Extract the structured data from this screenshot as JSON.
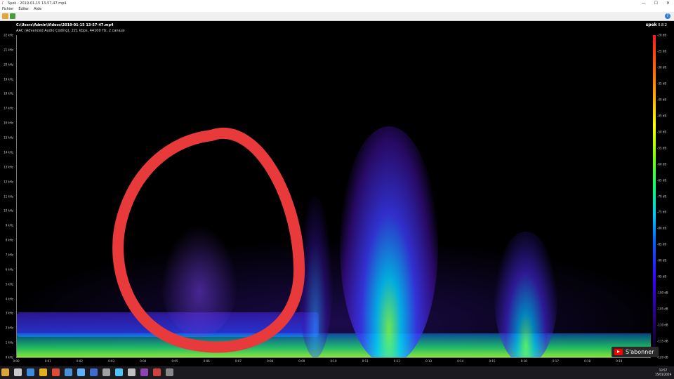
{
  "window": {
    "title": "Spek - 2019-01-15 13-57-47.mp4",
    "minimize": "—",
    "maximize": "☐",
    "close": "✕"
  },
  "menu": [
    "Fichier",
    "Éditer",
    "Aide"
  ],
  "file": {
    "path": "C:\\Users\\Admin\\Videos\\2019-01-15 13-57-47.mp4",
    "meta": "AAC (Advanced Audio Coding), 221 kbps, 44100 Hz, 2 canaux"
  },
  "app": {
    "name": "spek",
    "version": "0.8.2"
  },
  "freq_labels": [
    "22 kHz",
    "21 kHz",
    "20 kHz",
    "19 kHz",
    "18 kHz",
    "17 kHz",
    "16 kHz",
    "15 kHz",
    "14 kHz",
    "13 kHz",
    "12 kHz",
    "11 kHz",
    "10 kHz",
    "9 kHz",
    "8 kHz",
    "7 kHz",
    "6 kHz",
    "5 kHz",
    "4 kHz",
    "3 kHz",
    "2 kHz",
    "1 kHz",
    "0 kHz"
  ],
  "time_labels": [
    "0:00",
    "0:01",
    "0:02",
    "0:03",
    "0:04",
    "0:05",
    "0:06",
    "0:07",
    "0:08",
    "0:09",
    "0:10",
    "0:11",
    "0:12",
    "0:13",
    "0:14",
    "0:15",
    "0:16",
    "0:17",
    "0:18",
    "0:19"
  ],
  "db_labels": [
    "-20 dB",
    "-25 dB",
    "-30 dB",
    "-35 dB",
    "-40 dB",
    "-45 dB",
    "-50 dB",
    "-55 dB",
    "-60 dB",
    "-65 dB",
    "-70 dB",
    "-75 dB",
    "-80 dB",
    "-85 dB",
    "-90 dB",
    "-95 dB",
    "-100 dB",
    "-105 dB",
    "-110 dB",
    "-115 dB",
    "-120 dB"
  ],
  "overlay": {
    "subscribe_label": "S'abonner",
    "circle_color": "#e83a3a"
  },
  "clock": {
    "time": "13:57",
    "date": "15/01/2019"
  },
  "taskbar_icon_colors": [
    "#d9a53b",
    "#c9c9c9",
    "#3c8be0",
    "#e0b020",
    "#dd4b39",
    "#4a90d9",
    "#5fb0ff",
    "#3d6bd0",
    "#a0a0a0",
    "#4fc3f7",
    "#c0c0c0",
    "#8e44ad",
    "#d04040",
    "#888888"
  ]
}
